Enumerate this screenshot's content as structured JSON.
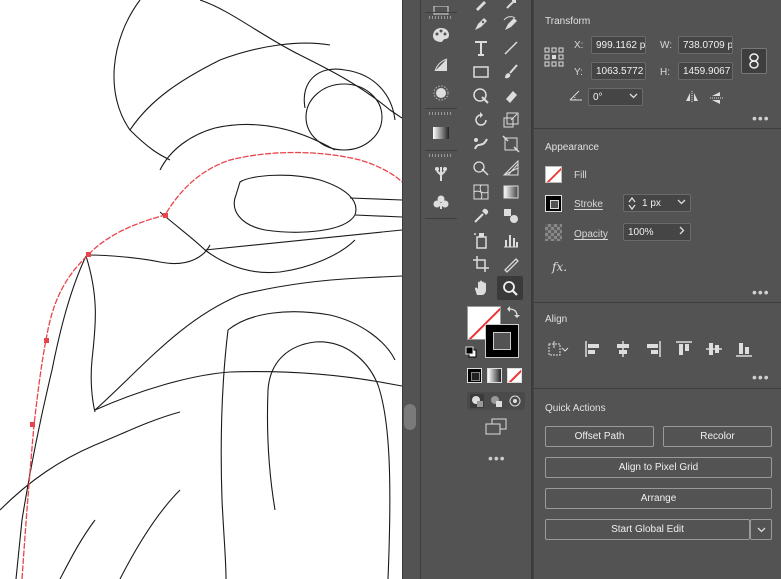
{
  "transform": {
    "title": "Transform",
    "x_label": "X:",
    "x_value": "999.1162 p",
    "y_label": "Y:",
    "y_value": "1063.5772 |",
    "w_label": "W:",
    "w_value": "738.0709 p",
    "h_label": "H:",
    "h_value": "1459.9067",
    "angle_value": "0°"
  },
  "appearance": {
    "title": "Appearance",
    "fill_label": "Fill",
    "stroke_label": "Stroke",
    "stroke_value": "1 px",
    "opacity_label": "Opacity",
    "opacity_value": "100%",
    "fx_label": "fx."
  },
  "align": {
    "title": "Align"
  },
  "quick_actions": {
    "title": "Quick Actions",
    "offset_path": "Offset Path",
    "recolor": "Recolor",
    "align_pixel_grid": "Align to Pixel Grid",
    "arrange": "Arrange",
    "start_global_edit": "Start Global Edit"
  },
  "colors": {
    "panel_bg": "#535353",
    "selection_path": "#e8454b",
    "canvas": "#ffffff"
  },
  "icons": [
    "swatch-icon",
    "brush-library-icon",
    "gradient-icon",
    "sun-icon",
    "transparency-icon",
    "symbols-icon",
    "club-icon"
  ]
}
